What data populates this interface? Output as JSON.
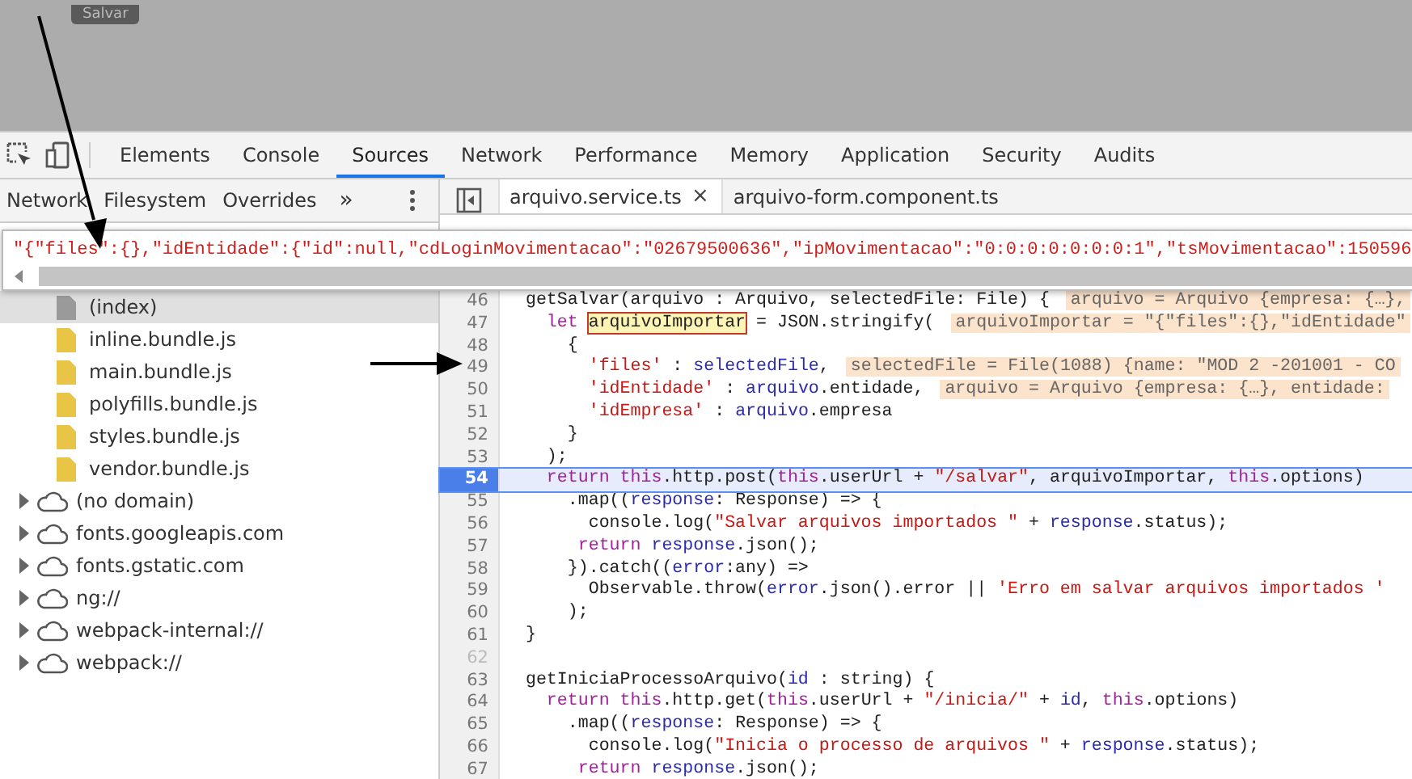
{
  "page": {
    "button": "Salvar"
  },
  "devtools": {
    "tabs": [
      {
        "label": "Elements",
        "selected": false
      },
      {
        "label": "Console",
        "selected": false
      },
      {
        "label": "Sources",
        "selected": true
      },
      {
        "label": "Network",
        "selected": false
      },
      {
        "label": "Performance",
        "selected": false
      },
      {
        "label": "Memory",
        "selected": false
      },
      {
        "label": "Application",
        "selected": false
      },
      {
        "label": "Security",
        "selected": false
      },
      {
        "label": "Audits",
        "selected": false
      }
    ],
    "navigator_tabs": [
      "Network",
      "Filesystem",
      "Overrides"
    ],
    "more": "»",
    "files": [
      {
        "label": "(index)",
        "kind": "document",
        "selected": true
      },
      {
        "label": "inline.bundle.js",
        "kind": "script",
        "selected": false
      },
      {
        "label": "main.bundle.js",
        "kind": "script",
        "selected": false
      },
      {
        "label": "polyfills.bundle.js",
        "kind": "script",
        "selected": false
      },
      {
        "label": "styles.bundle.js",
        "kind": "script",
        "selected": false
      },
      {
        "label": "vendor.bundle.js",
        "kind": "script",
        "selected": false
      }
    ],
    "domains": [
      {
        "label": "(no domain)",
        "expanded": false
      },
      {
        "label": "fonts.googleapis.com",
        "expanded": false
      },
      {
        "label": "fonts.gstatic.com",
        "expanded": false
      },
      {
        "label": "ng://",
        "expanded": false
      },
      {
        "label": "webpack-internal://",
        "expanded": false
      },
      {
        "label": "webpack://",
        "expanded": false
      }
    ],
    "editor_tabs": [
      {
        "label": "arquivo.service.ts",
        "selected": true,
        "close": "×"
      },
      {
        "label": "arquivo-form.component.ts",
        "selected": false
      }
    ],
    "popup": {
      "value": "\"{\"files\":{},\"idEntidade\":{\"id\":null,\"cdLoginMovimentacao\":\"02679500636\",\"ipMovimentacao\":\"0:0:0:0:0:0:0:1\",\"tsMovimentacao\":150596"
    },
    "code_lines": [
      {
        "number": "46",
        "current": false,
        "segments": [
          {
            "kind": "plain",
            "text": "  getSalvar(arquivo : Arquivo, selectedFile: File) {"
          },
          {
            "kind": "inline",
            "text": "arquivo = Arquivo {empresa: {…},"
          }
        ]
      },
      {
        "number": "47",
        "current": false,
        "segments": [
          {
            "kind": "keyword",
            "text": "    let "
          },
          {
            "kind": "match",
            "text": "arquivoImportar"
          },
          {
            "kind": "plain",
            "text": " = JSON.stringify("
          },
          {
            "kind": "inline",
            "text": "arquivoImportar = \"{\"files\":{},\"idEntidade\""
          }
        ]
      },
      {
        "number": "48",
        "current": false,
        "segments": [
          {
            "kind": "plain",
            "text": "      {"
          }
        ]
      },
      {
        "number": "49",
        "current": false,
        "segments": [
          {
            "kind": "string",
            "text": "        'files'"
          },
          {
            "kind": "plain",
            "text": " : "
          },
          {
            "kind": "var",
            "text": "selectedFile"
          },
          {
            "kind": "plain",
            "text": ","
          },
          {
            "kind": "inline",
            "text": "selectedFile = File(1088) {name: \"MOD 2 -201001 - CO"
          }
        ]
      },
      {
        "number": "50",
        "current": false,
        "segments": [
          {
            "kind": "string",
            "text": "        'idEntidade'"
          },
          {
            "kind": "plain",
            "text": " : "
          },
          {
            "kind": "var",
            "text": "arquivo"
          },
          {
            "kind": "plain",
            "text": ".entidade,"
          },
          {
            "kind": "inline",
            "text": "arquivo = Arquivo {empresa: {…}, entidade:"
          }
        ]
      },
      {
        "number": "51",
        "current": false,
        "segments": [
          {
            "kind": "string",
            "text": "        'idEmpresa'"
          },
          {
            "kind": "plain",
            "text": " : "
          },
          {
            "kind": "var",
            "text": "arquivo"
          },
          {
            "kind": "plain",
            "text": ".empresa"
          }
        ]
      },
      {
        "number": "52",
        "current": false,
        "segments": [
          {
            "kind": "plain",
            "text": "      }"
          }
        ]
      },
      {
        "number": "53",
        "current": false,
        "segments": [
          {
            "kind": "plain",
            "text": "    );"
          }
        ]
      },
      {
        "number": "54",
        "current": true,
        "segments": [
          {
            "kind": "keyword",
            "text": "    return this"
          },
          {
            "kind": "plain",
            "text": ".http.post("
          },
          {
            "kind": "keyword",
            "text": "this"
          },
          {
            "kind": "plain",
            "text": ".userUrl + "
          },
          {
            "kind": "string",
            "text": "\"/salvar\""
          },
          {
            "kind": "plain",
            "text": ", arquivoImportar, "
          },
          {
            "kind": "keyword",
            "text": "this"
          },
          {
            "kind": "plain",
            "text": ".options)"
          }
        ]
      },
      {
        "number": "55",
        "current": false,
        "segments": [
          {
            "kind": "plain",
            "text": "      .map(("
          },
          {
            "kind": "var",
            "text": "response"
          },
          {
            "kind": "plain",
            "text": ": Response) => {"
          }
        ]
      },
      {
        "number": "56",
        "current": false,
        "segments": [
          {
            "kind": "plain",
            "text": "        console.log("
          },
          {
            "kind": "string",
            "text": "\"Salvar arquivos importados \""
          },
          {
            "kind": "plain",
            "text": " + "
          },
          {
            "kind": "var",
            "text": "response"
          },
          {
            "kind": "plain",
            "text": ".status);"
          }
        ]
      },
      {
        "number": "57",
        "current": false,
        "segments": [
          {
            "kind": "keyword",
            "text": "       return "
          },
          {
            "kind": "var",
            "text": "response"
          },
          {
            "kind": "plain",
            "text": ".json();"
          }
        ]
      },
      {
        "number": "58",
        "current": false,
        "segments": [
          {
            "kind": "plain",
            "text": "      }).catch(("
          },
          {
            "kind": "var",
            "text": "error"
          },
          {
            "kind": "plain",
            "text": ":any) =>"
          }
        ]
      },
      {
        "number": "59",
        "current": false,
        "segments": [
          {
            "kind": "plain",
            "text": "        Observable.throw("
          },
          {
            "kind": "var",
            "text": "error"
          },
          {
            "kind": "plain",
            "text": ".json().error || "
          },
          {
            "kind": "string",
            "text": "'Erro em salvar arquivos importados '"
          }
        ]
      },
      {
        "number": "60",
        "current": false,
        "segments": [
          {
            "kind": "plain",
            "text": "      );"
          }
        ]
      },
      {
        "number": "61",
        "current": false,
        "segments": [
          {
            "kind": "plain",
            "text": "  }"
          }
        ]
      },
      {
        "number": "62",
        "current": false
      },
      {
        "number": "63",
        "current": false,
        "segments": [
          {
            "kind": "plain",
            "text": "  getIniciaProcessoArquivo("
          },
          {
            "kind": "var",
            "text": "id"
          },
          {
            "kind": "plain",
            "text": " : string) {"
          }
        ]
      },
      {
        "number": "64",
        "current": false,
        "segments": [
          {
            "kind": "keyword",
            "text": "    return this"
          },
          {
            "kind": "plain",
            "text": ".http.get("
          },
          {
            "kind": "keyword",
            "text": "this"
          },
          {
            "kind": "plain",
            "text": ".userUrl + "
          },
          {
            "kind": "string",
            "text": "\"/inicia/\""
          },
          {
            "kind": "plain",
            "text": " + "
          },
          {
            "kind": "var",
            "text": "id"
          },
          {
            "kind": "plain",
            "text": ", "
          },
          {
            "kind": "keyword",
            "text": "this"
          },
          {
            "kind": "plain",
            "text": ".options)"
          }
        ]
      },
      {
        "number": "65",
        "current": false,
        "segments": [
          {
            "kind": "plain",
            "text": "      .map(("
          },
          {
            "kind": "var",
            "text": "response"
          },
          {
            "kind": "plain",
            "text": ": Response) => {"
          }
        ]
      },
      {
        "number": "66",
        "current": false,
        "segments": [
          {
            "kind": "plain",
            "text": "        console.log("
          },
          {
            "kind": "string",
            "text": "\"Inicia o processo de arquivos \""
          },
          {
            "kind": "plain",
            "text": " + "
          },
          {
            "kind": "var",
            "text": "response"
          },
          {
            "kind": "plain",
            "text": ".status);"
          }
        ]
      },
      {
        "number": "67",
        "current": false,
        "segments": [
          {
            "kind": "keyword",
            "text": "       return "
          },
          {
            "kind": "var",
            "text": "response"
          },
          {
            "kind": "plain",
            "text": ".json();"
          }
        ]
      }
    ]
  }
}
